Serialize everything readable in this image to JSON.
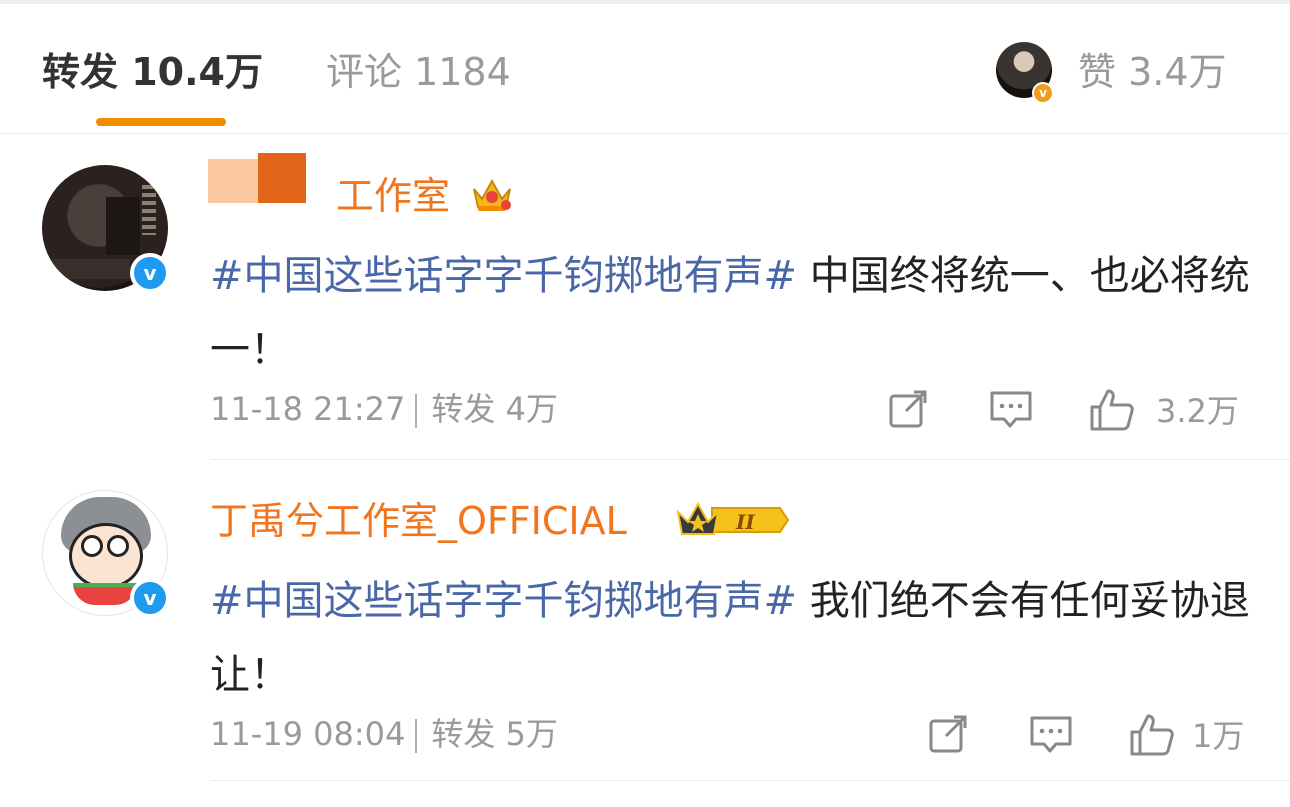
{
  "tabs": {
    "forward": {
      "label": "转发 10.4万"
    },
    "comment": {
      "label": "评论 1184"
    },
    "like": {
      "label": "赞 3.4万",
      "avatar_badge": "v"
    }
  },
  "accent_color": "#f08c00",
  "hashtag_color": "#4a67a8",
  "username_color": "#f0751d",
  "reposts": [
    {
      "username": "工作室",
      "avatar_badge": "v",
      "hashtag": "#中国这些话字字千钧掷地有声#",
      "text": " 中国终将统一、也必将统一！",
      "time": "11-18 21:27",
      "forward_label": "转发 4万",
      "like_count": "3.2万"
    },
    {
      "username": "丁禹兮工作室_OFFICIAL",
      "avatar_badge": "v",
      "hashtag": "#中国这些话字字千钧掷地有声#",
      "text": " 我们绝不会有任何妥协退让！",
      "time": "11-19 08:04",
      "forward_label": "转发 5万",
      "like_count": "1万",
      "level_badge": "II"
    }
  ],
  "icons": [
    "share-icon",
    "comment-icon",
    "like-icon",
    "crown-icon",
    "verified-icon"
  ]
}
